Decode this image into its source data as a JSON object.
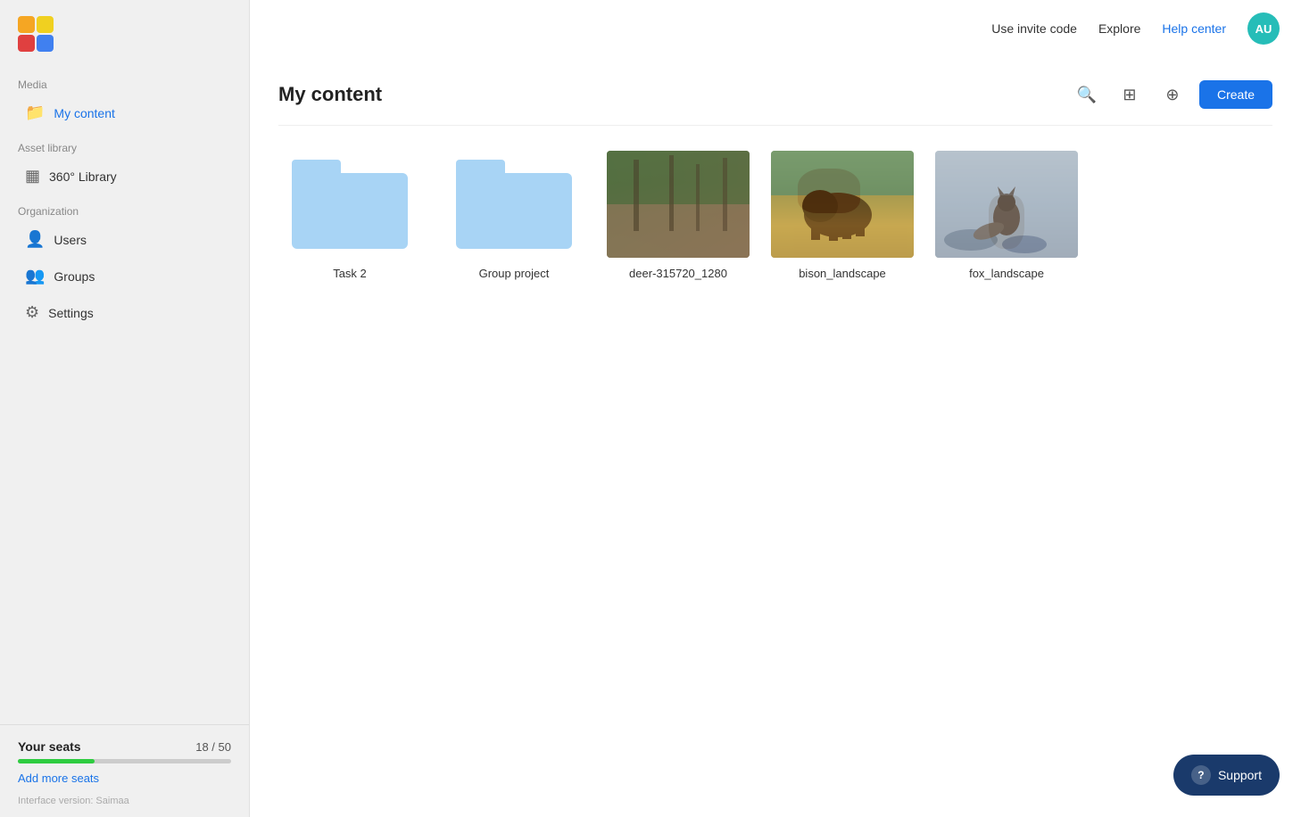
{
  "app": {
    "logo_alt": "App logo"
  },
  "topnav": {
    "invite_code": "Use invite code",
    "explore": "Explore",
    "help_center": "Help center",
    "avatar_initials": "AU"
  },
  "sidebar": {
    "media_label": "Media",
    "my_content": "My content",
    "asset_library_label": "Asset library",
    "library_360": "360° Library",
    "organization_label": "Organization",
    "users": "Users",
    "groups": "Groups",
    "settings": "Settings",
    "seats": {
      "label": "Your seats",
      "count": "18 / 50",
      "used": 18,
      "total": 50,
      "progress_pct": 36,
      "add_more": "Add more seats"
    },
    "version": "Interface version: Saimaa"
  },
  "content": {
    "title": "My content",
    "create_btn": "Create",
    "items": [
      {
        "type": "folder",
        "label": "Task 2"
      },
      {
        "type": "folder",
        "label": "Group project"
      },
      {
        "type": "image",
        "label": "deer-315720_1280",
        "img_type": "deer"
      },
      {
        "type": "image",
        "label": "bison_landscape",
        "img_type": "bison"
      },
      {
        "type": "image",
        "label": "fox_landscape",
        "img_type": "fox"
      }
    ]
  },
  "support": {
    "label": "Support",
    "icon": "?"
  }
}
